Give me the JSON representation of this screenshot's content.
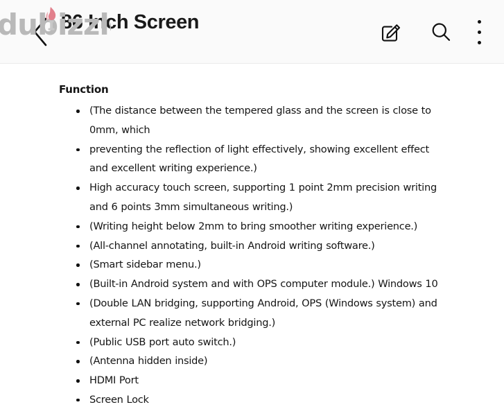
{
  "watermark": {
    "brand": "dubizzle",
    "icon": "flame-torch-icon",
    "text_color": "#b9b9b9",
    "flame_color": "#e2808c"
  },
  "header": {
    "back_icon": "back-chevron-icon",
    "title": "86 Inch Screen",
    "background": "#fafafa",
    "actions": [
      {
        "name": "edit-icon",
        "label": "Edit"
      },
      {
        "name": "search-icon",
        "label": "Search"
      },
      {
        "name": "more-icon",
        "label": "More options"
      }
    ]
  },
  "content": {
    "section_title": "Function",
    "bullets": [
      "(The distance between the tempered glass and the screen is close to 0mm, which",
      "preventing the reflection of light effectively, showing excellent effect and excellent writing experience.)",
      "High accuracy touch screen, supporting 1 point 2mm precision writing and 6 points 3mm simultaneous writing.)",
      "(Writing height below 2mm to bring smoother writing experience.)",
      "(All-channel annotating, built-in Android writing software.)",
      "(Smart sidebar menu.)",
      "(Built-in Android system and with OPS computer module.) Windows 10",
      "(Double LAN bridging, supporting Android, OPS (Windows system) and external PC realize network bridging.)",
      "(Public USB port auto switch.)",
      "(Antenna hidden inside)",
      "HDMI Port",
      "Screen Lock"
    ]
  }
}
